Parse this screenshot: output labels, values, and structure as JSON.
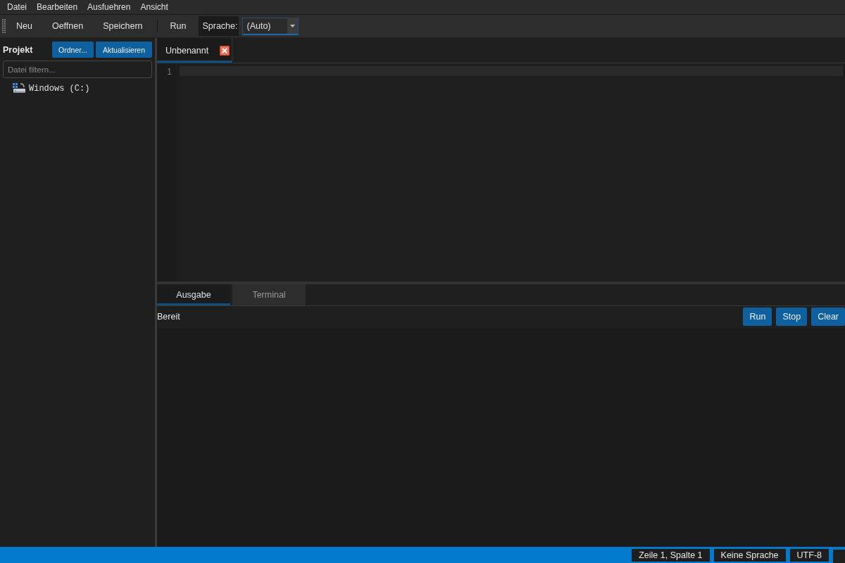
{
  "menu_bar": {
    "items": [
      "Datei",
      "Bearbeiten",
      "Ausfuehren",
      "Ansicht"
    ]
  },
  "toolbar": {
    "items": [
      {
        "kind": "button",
        "label": "Neu"
      },
      {
        "kind": "button",
        "label": "Oeffnen"
      },
      {
        "kind": "button",
        "label": "Speichern"
      },
      {
        "kind": "separator"
      },
      {
        "kind": "button",
        "label": "Run"
      },
      {
        "kind": "label",
        "label": "Sprache:"
      },
      {
        "kind": "select",
        "value": "(Auto)"
      }
    ]
  },
  "project_panel": {
    "title": "Projekt",
    "buttons": [
      "Ordner...",
      "Aktualisieren"
    ],
    "filter": {
      "placeholder": "Datei filtern..."
    },
    "tree": [
      {
        "label": "Windows (C:)",
        "kind": "drive",
        "selected": false
      }
    ]
  },
  "editor": {
    "tabs": [
      {
        "label": "Unbenannt",
        "selected": true
      }
    ],
    "line_numbers": [
      "1"
    ]
  },
  "output_panel": {
    "tabs": [
      {
        "label": "Ausgabe",
        "selected": true
      },
      {
        "label": "Terminal",
        "selected": false
      }
    ],
    "status": "Bereit",
    "buttons": [
      "Run",
      "Stop",
      "Clear"
    ]
  },
  "status_bar": {
    "items": [
      "Zeile 1, Spalte 1",
      "Keine Sprache",
      "UTF-8"
    ]
  }
}
